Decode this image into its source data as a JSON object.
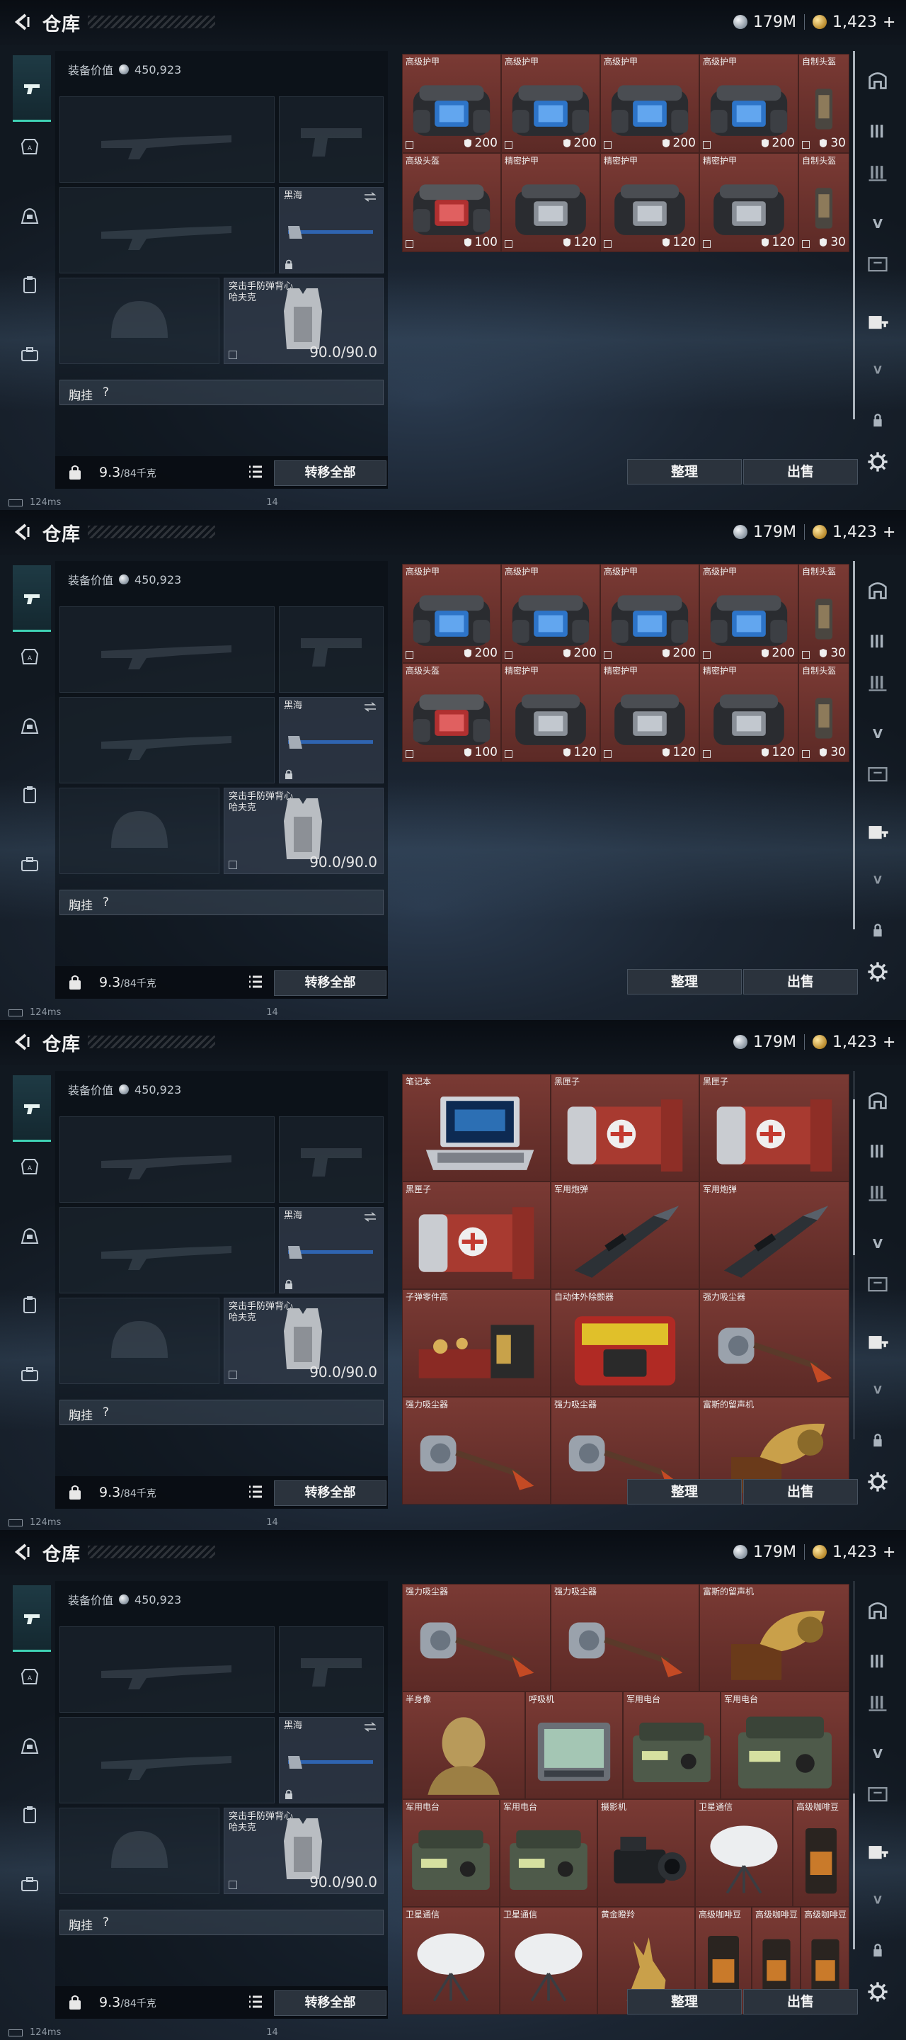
{
  "header": {
    "title": "仓库",
    "silver": "179M",
    "gold": "1,423",
    "plus": "+"
  },
  "equipment": {
    "value_label": "装备价值",
    "value": "450,923",
    "secondary_weapon": {
      "name": "黑海"
    },
    "armor": {
      "name_line1": "突击手防弹背心",
      "name_line2": "哈夫克",
      "durability": "90.0/90.0"
    },
    "rig": {
      "label": "胸挂",
      "hint": "?"
    },
    "weight": {
      "current": "9.3",
      "max": "/84千克"
    },
    "transfer_all": "转移全部"
  },
  "actions": {
    "sort": "整理",
    "sell": "出售"
  },
  "status": {
    "ping": "124ms",
    "num": "14"
  },
  "screens": [
    {
      "items": [
        [
          {
            "name": "高级护甲",
            "durability": "200",
            "type": "armor-blue"
          },
          {
            "name": "高级护甲",
            "durability": "200",
            "type": "armor-blue"
          },
          {
            "name": "高级护甲",
            "durability": "200",
            "type": "armor-blue"
          },
          {
            "name": "高级护甲",
            "durability": "200",
            "type": "armor-blue"
          },
          {
            "name": "自制头盔",
            "durability": "30",
            "type": "slim"
          }
        ],
        [
          {
            "name": "高级头盔",
            "durability": "100",
            "type": "armor-red"
          },
          {
            "name": "精密护甲",
            "durability": "120",
            "type": "armor-gray"
          },
          {
            "name": "精密护甲",
            "durability": "120",
            "type": "armor-gray"
          },
          {
            "name": "精密护甲",
            "durability": "120",
            "type": "armor-gray"
          },
          {
            "name": "自制头盔",
            "durability": "30",
            "type": "slim"
          }
        ]
      ]
    },
    {
      "items": [
        [
          {
            "name": "高级护甲",
            "durability": "200",
            "type": "armor-blue"
          },
          {
            "name": "高级护甲",
            "durability": "200",
            "type": "armor-blue"
          },
          {
            "name": "高级护甲",
            "durability": "200",
            "type": "armor-blue"
          },
          {
            "name": "高级护甲",
            "durability": "200",
            "type": "armor-blue"
          },
          {
            "name": "自制头盔",
            "durability": "30",
            "type": "slim"
          }
        ],
        [
          {
            "name": "高级头盔",
            "durability": "100",
            "type": "armor-red"
          },
          {
            "name": "精密护甲",
            "durability": "120",
            "type": "armor-gray"
          },
          {
            "name": "精密护甲",
            "durability": "120",
            "type": "armor-gray"
          },
          {
            "name": "精密护甲",
            "durability": "120",
            "type": "armor-gray"
          },
          {
            "name": "自制头盔",
            "durability": "30",
            "type": "slim"
          }
        ]
      ]
    },
    {
      "items": [
        [
          {
            "name": "笔记本",
            "type": "laptop"
          },
          {
            "name": "黑匣子",
            "type": "blackbox"
          },
          {
            "name": "黑匣子",
            "type": "blackbox"
          }
        ],
        [
          {
            "name": "黑匣子",
            "type": "blackbox"
          },
          {
            "name": "军用炮弹",
            "type": "shell"
          },
          {
            "name": "军用炮弹",
            "type": "shell"
          }
        ],
        [
          {
            "name": "子弹零件高",
            "type": "parts"
          },
          {
            "name": "自动体外除颤器",
            "type": "aed"
          },
          {
            "name": "强力吸尘器",
            "type": "vacuum"
          }
        ],
        [
          {
            "name": "强力吸尘器",
            "type": "vacuum"
          },
          {
            "name": "强力吸尘器",
            "type": "vacuum"
          },
          {
            "name": "富斯的留声机",
            "type": "gramophone"
          }
        ]
      ]
    },
    {
      "items": [
        [
          {
            "name": "强力吸尘器",
            "type": "vacuum"
          },
          {
            "name": "强力吸尘器",
            "type": "vacuum"
          },
          {
            "name": "富斯的留声机",
            "type": "gramophone"
          }
        ],
        [
          {
            "name": "半身像",
            "type": "bust"
          },
          {
            "name": "呼吸机",
            "type": "monitor"
          },
          {
            "name": "军用电台",
            "type": "radio"
          },
          {
            "name": "军用电台",
            "type": "radio"
          }
        ],
        [
          {
            "name": "军用电台",
            "type": "radio"
          },
          {
            "name": "军用电台",
            "type": "radio"
          },
          {
            "name": "摄影机",
            "type": "camera"
          },
          {
            "name": "卫星通信",
            "type": "dish"
          },
          {
            "name": "高级咖啡豆",
            "type": "coffee"
          }
        ],
        [
          {
            "name": "卫星通信",
            "type": "dish"
          },
          {
            "name": "卫星通信",
            "type": "dish"
          },
          {
            "name": "黄金瞪羚",
            "type": "gazelle"
          },
          {
            "name": "高级咖啡豆",
            "type": "coffee"
          },
          {
            "name": "高级咖啡豆",
            "type": "coffee"
          },
          {
            "name": "高级咖啡豆",
            "type": "coffee"
          }
        ]
      ]
    }
  ],
  "colors": {
    "accent": "#3fd1b4",
    "cell_red": "#6b302b",
    "panel_dark": "#111820"
  }
}
